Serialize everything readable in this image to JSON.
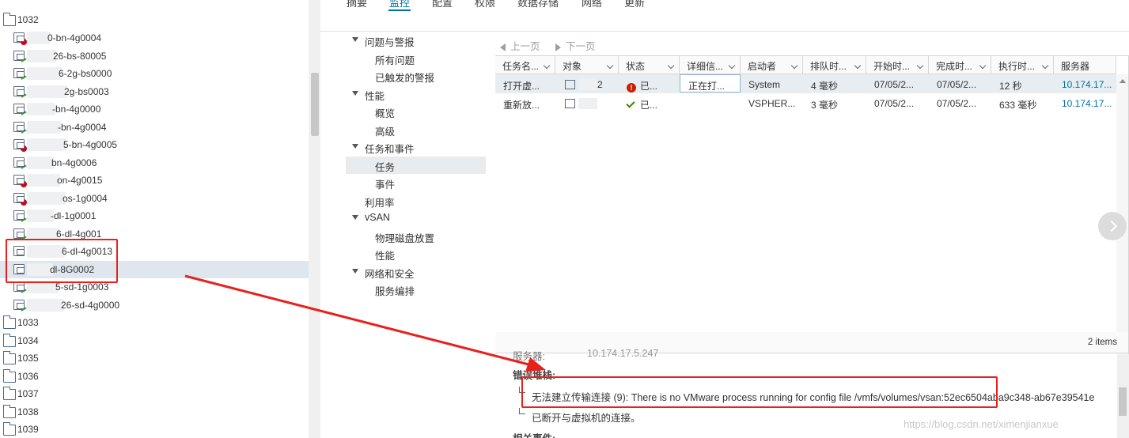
{
  "tree": {
    "top_folder": "1032",
    "vms": [
      {
        "label": "0-bn-4g0004",
        "status": "error"
      },
      {
        "label": "26-bs-80005",
        "status": "run"
      },
      {
        "label": "6-2g-bs0000",
        "status": "run"
      },
      {
        "label": "2g-bs0003",
        "status": "run"
      },
      {
        "label": "-bn-4g0000",
        "status": "run"
      },
      {
        "label": "-bn-4g0004",
        "status": "run"
      },
      {
        "label": "5-bn-4g0005",
        "status": "error"
      },
      {
        "label": "bn-4g0006",
        "status": "run"
      },
      {
        "label": "on-4g0015",
        "status": "error"
      },
      {
        "label": "os-1g0004",
        "status": "error"
      },
      {
        "label": "-dl-1g0001",
        "status": "run"
      },
      {
        "label": "6-dl-4g001",
        "status": "run"
      },
      {
        "label": "6-dl-4g0013",
        "status": "off"
      },
      {
        "label": "dl-8G0002",
        "status": "off"
      },
      {
        "label": "5-sd-1g0003",
        "status": "run"
      },
      {
        "label": "26-sd-4g0000",
        "status": "run"
      }
    ],
    "folders": [
      "1033",
      "1034",
      "1035",
      "1036",
      "1037",
      "1038",
      "1039"
    ]
  },
  "top_tabs": [
    "摘要",
    "监控",
    "配置",
    "权限",
    "数据存储",
    "网络",
    "更新"
  ],
  "nav": [
    {
      "label": "问题与警报",
      "level": 0,
      "expand": true
    },
    {
      "label": "所有问题",
      "level": 1
    },
    {
      "label": "已触发的警报",
      "level": 1
    },
    {
      "label": "性能",
      "level": 0,
      "expand": true
    },
    {
      "label": "概览",
      "level": 1
    },
    {
      "label": "高级",
      "level": 1
    },
    {
      "label": "任务和事件",
      "level": 0,
      "expand": true
    },
    {
      "label": "任务",
      "level": 1,
      "selected": true
    },
    {
      "label": "事件",
      "level": 1
    },
    {
      "label": "利用率",
      "level": 0
    },
    {
      "label": "vSAN",
      "level": 0,
      "expand": true
    },
    {
      "label": "物理磁盘放置",
      "level": 1
    },
    {
      "label": "性能",
      "level": 1
    },
    {
      "label": "网络和安全",
      "level": 0,
      "expand": true
    },
    {
      "label": "服务编排",
      "level": 1
    }
  ],
  "pager": {
    "prev": "上一页",
    "next": "下一页"
  },
  "grid": {
    "columns": [
      "任务名...",
      "对象",
      "状态",
      "详细信...",
      "启动者",
      "排队时...",
      "开始时...",
      "完成时...",
      "执行时...",
      "服务器"
    ],
    "rows": [
      {
        "task": "打开虚...",
        "object": "2",
        "status": "已...",
        "detail": "正在打...",
        "initiator": "System",
        "queued": "4 毫秒",
        "start": "07/05/2...",
        "end": "07/05/2...",
        "exec": "12 秒",
        "server": "10.174.17..."
      },
      {
        "task": "重新放...",
        "object": "",
        "status": "已...",
        "detail": "",
        "initiator": "VSPHER...",
        "queued": "3 毫秒",
        "start": "07/05/2...",
        "end": "07/05/2...",
        "exec": "633 毫秒",
        "server": "10.174.17..."
      }
    ],
    "count": "2 items"
  },
  "details": {
    "partial_label": "服务器:",
    "partial_value": "10.174.17.5.247",
    "stack_title": "错误堆栈:",
    "error_line": "无法建立传输连接 (9): There is no VMware process running for config file /vmfs/volumes/vsan:52ec6504aba9c348-ab67e39541e",
    "disconnect_line": "已断开与虚拟机的连接。",
    "related_title": "相关事件:"
  },
  "watermark": "https://blog.csdn.net/ximenjianxue",
  "colors": {
    "selection": "#dfe6ee",
    "annotation_red": "#e8211c",
    "link": "#0072a3"
  }
}
